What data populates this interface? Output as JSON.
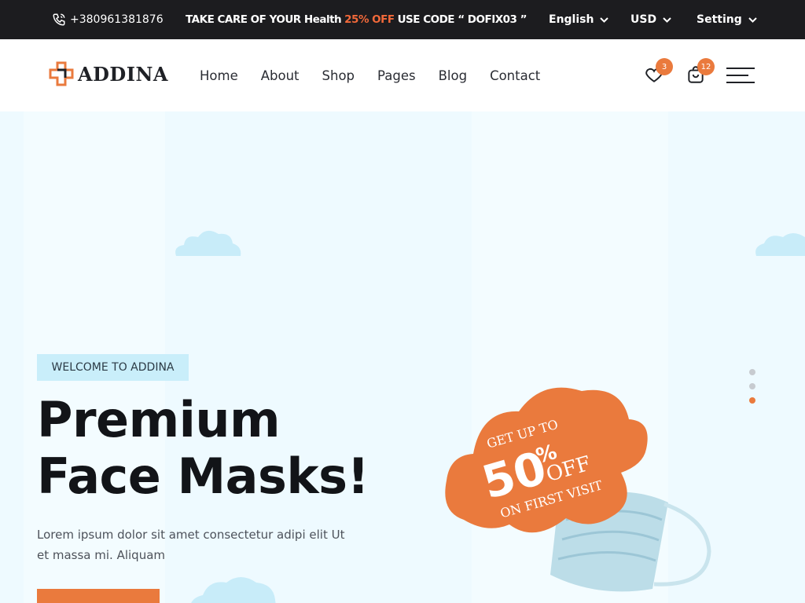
{
  "topbar": {
    "phone": "+380961381876",
    "promo_prefix": "TAKE CARE OF YOUR Health",
    "promo_off": "25% OFF",
    "promo_suffix": "USE CODE “ DOFIX03 ”",
    "language": "English",
    "currency": "USD",
    "setting": "Setting"
  },
  "header": {
    "logo": "ADDINA",
    "nav": [
      "Home",
      "About",
      "Shop",
      "Pages",
      "Blog",
      "Contact"
    ],
    "wishlist_count": "3",
    "cart_count": "12"
  },
  "hero": {
    "tag": "WELCOME TO ADDINA",
    "headline_line1": "Premium",
    "headline_line2": "Face Masks!",
    "description": "Lorem ipsum dolor sit amet consectetur adipi elit Ut et massa mi. Aliquam",
    "badge_top": "GET UP TO",
    "badge_big": "50",
    "badge_pct": "%",
    "badge_off": "OFF",
    "badge_bottom": "ON FIRST VISIT",
    "slide_count": 3,
    "active_slide": 3
  },
  "colors": {
    "accent": "#ea7a3d",
    "topbar_bg": "#1c1c1f",
    "hero_bg": "#eefaff",
    "tag_bg": "#c9eefa"
  },
  "icons": [
    "phone-icon",
    "chevron-down-icon",
    "logo-cross-icon",
    "heart-icon",
    "cart-icon",
    "hamburger-menu-icon"
  ]
}
